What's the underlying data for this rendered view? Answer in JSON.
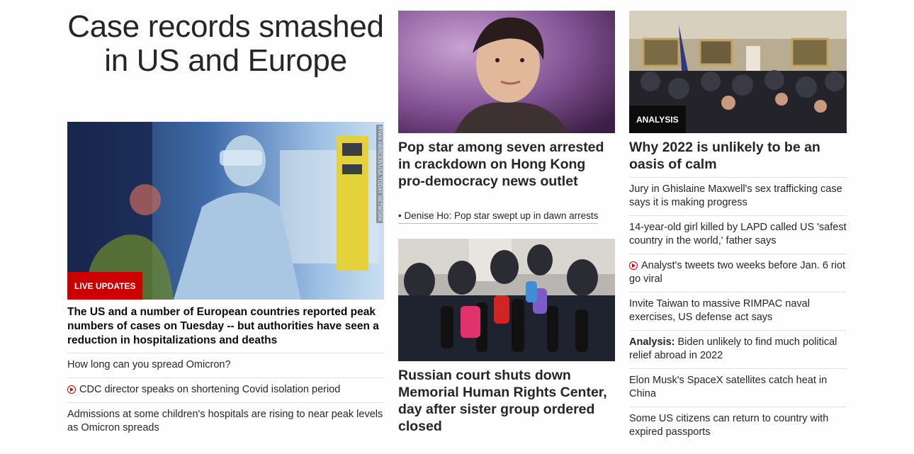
{
  "main": {
    "headline": "Case records smashed in US and Europe",
    "badge": "LIVE UPDATES",
    "photo_credit": "RYAN HERCER/USA TODAY NETWORK",
    "summary": "The US and a number of European countries reported peak numbers of cases on Tuesday -- but authorities have seen a reduction in hospitalizations and deaths",
    "links": [
      {
        "text": "How long can you spread Omicron?",
        "video": false
      },
      {
        "text": "CDC director speaks on shortening Covid isolation period",
        "video": true
      },
      {
        "text": "Admissions at some children's hospitals are rising to near peak levels as Omicron spreads",
        "video": false
      }
    ]
  },
  "middle": {
    "story1": {
      "title": "Pop star among seven arrested in crackdown on Hong Kong pro-democracy news outlet",
      "related": "• Denise Ho: Pop star swept up in dawn arrests"
    },
    "story2": {
      "title": "Russian court shuts down Memorial Human Rights Center, day after sister group ordered closed"
    }
  },
  "right": {
    "badge": "ANALYSIS",
    "title": "Why 2022 is unlikely to be an oasis of calm",
    "links": [
      {
        "prefix": "",
        "text": "Jury in Ghislaine Maxwell's sex trafficking case says it is making progress",
        "video": false
      },
      {
        "prefix": "",
        "text": "14-year-old girl killed by LAPD called US 'safest country in the world,' father says",
        "video": false
      },
      {
        "prefix": "",
        "text": "Analyst's tweets two weeks before Jan. 6 riot go viral",
        "video": true
      },
      {
        "prefix": "",
        "text": "Invite Taiwan to massive RIMPAC naval exercises, US defense act says",
        "video": false
      },
      {
        "prefix": "Analysis:",
        "text": "Biden unlikely to find much political relief abroad in 2022",
        "video": false
      },
      {
        "prefix": "",
        "text": "Elon Musk's SpaceX satellites catch heat in China",
        "video": false
      },
      {
        "prefix": "",
        "text": "Some US citizens can return to country with expired passports",
        "video": false
      }
    ]
  },
  "colors": {
    "accent": "#cc0000",
    "text": "#262626",
    "divider": "#e0e0e0"
  },
  "icons": {
    "video": "play-circle-icon"
  }
}
